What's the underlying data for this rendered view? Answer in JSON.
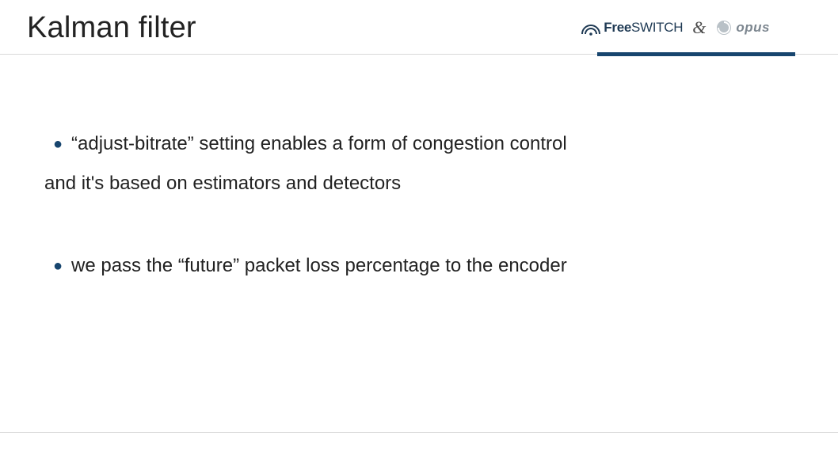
{
  "header": {
    "title": "Kalman filter",
    "logo_freeswitch_prefix": "Free",
    "logo_freeswitch_suffix": "SWITCH",
    "ampersand": "&",
    "logo_opus": "opus",
    "accent_color": "#17456e"
  },
  "bullets": [
    {
      "text": " “adjust-bitrate” setting enables a form of congestion control",
      "continuation": "and it's based on estimators and detectors"
    },
    {
      "text": "we pass the “future” packet loss percentage to the encoder"
    }
  ]
}
